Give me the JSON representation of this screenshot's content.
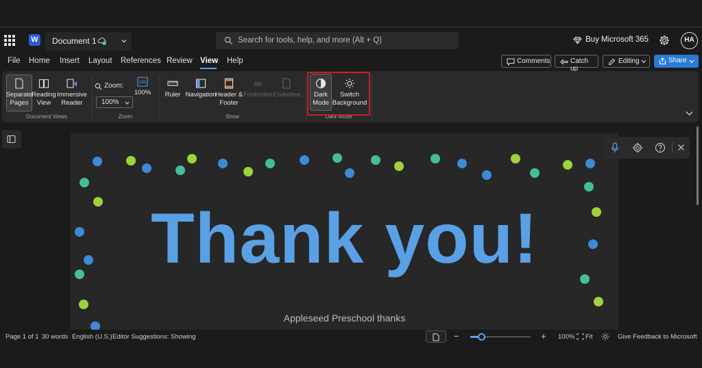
{
  "title_bar": {
    "doc_name": "Document 1",
    "search_placeholder": "Search for tools, help, and more (Alt + Q)",
    "buy_label": "Buy Microsoft 365",
    "avatar_initials": "HA",
    "app_icon_letter": "W"
  },
  "menu": {
    "tabs": [
      "File",
      "Home",
      "Insert",
      "Layout",
      "References",
      "Review",
      "View",
      "Help"
    ],
    "active_tab": "View",
    "comments": "Comments",
    "catch_up": "Catch up",
    "editing": "Editing",
    "share": "Share"
  },
  "ribbon": {
    "document_views": {
      "label": "Document Views",
      "separate_pages": [
        "Separate",
        "Pages"
      ],
      "reading_view": [
        "Reading",
        "View"
      ],
      "immersive_reader": [
        "Immersive",
        "Reader"
      ]
    },
    "zoom": {
      "label": "Zoom",
      "zoom_label": "Zoom:",
      "zoom_value": "100%",
      "hundred_label": "100%"
    },
    "show": {
      "label": "Show",
      "ruler": "Ruler",
      "navigation": "Navigation",
      "header_footer": [
        "Header &",
        "Footer"
      ],
      "footnotes": "Footnotes",
      "endnotes": "Endnotes"
    },
    "dark_mode": {
      "label": "Dark Mode",
      "dark_mode_btn": [
        "Dark",
        "Mode"
      ],
      "switch_background": [
        "Switch",
        "Background"
      ]
    }
  },
  "document": {
    "headline": "Thank you!",
    "subtitle": "Appleseed Preschool thanks",
    "dot_colors": [
      "#3d8ad6",
      "#9fd23c",
      "#45bd9a"
    ]
  },
  "status": {
    "page": "Page 1 of 1",
    "words": "30 words",
    "language": "English (U.S.)",
    "editor": "Editor Suggestions: Showing",
    "zoom": "100%",
    "fit": "Fit",
    "feedback": "Give Feedback to Microsoft",
    "zoom_slider_fraction": 0.19
  },
  "colors": {
    "accent": "#2b7bd6",
    "highlight": "#c4202a",
    "headline": "#5aa0e4"
  }
}
